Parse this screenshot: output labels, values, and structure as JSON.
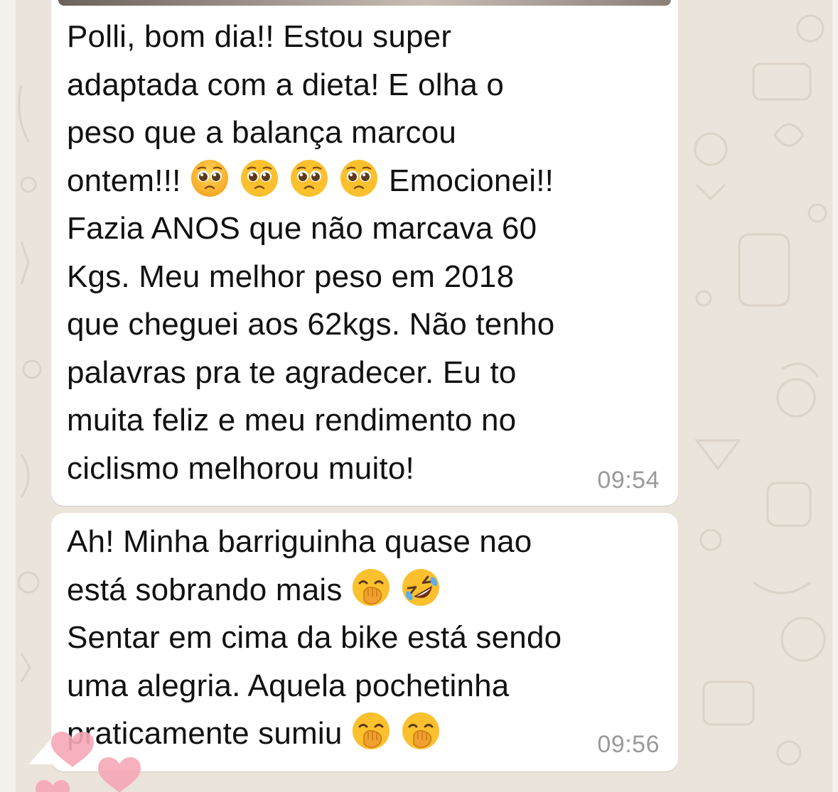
{
  "chat": {
    "messages": [
      {
        "id": "msg-1",
        "lines": [
          "Polli, bom dia!! Estou super",
          "adaptada com a dieta! E olha o",
          "peso que a balança marcou",
          "ontem!!!",
          "Emocionei!!",
          "Fazia ANOS que não marcava 60",
          "Kgs. Meu melhor peso em 2018",
          "que cheguei aos 62kgs. Não tenho",
          "palavras pra te agradecer. Eu to",
          "muita feliz e meu rendimento no",
          "ciclismo melhorou muito!"
        ],
        "time": "09:54",
        "emojis": [
          "pleading-face",
          "pleading-face",
          "pleading-face",
          "pleading-face"
        ]
      },
      {
        "id": "msg-2",
        "lines": [
          "Ah! Minha barriguinha quase nao",
          "está sobrando mais",
          "Sentar em cima da bike está sendo",
          "uma alegria. Aquela pochetinha",
          "praticamente sumiu"
        ],
        "time": "09:56",
        "emojis_line2": [
          "face-with-hand-over-mouth",
          "rolling-on-floor-laughing"
        ],
        "emojis_line5": [
          "face-with-hand-over-mouth",
          "face-with-hand-over-mouth"
        ]
      }
    ]
  },
  "colors": {
    "wallpaper": "#ece5dd",
    "bubble": "#ffffff",
    "text": "#111111",
    "timestamp": "#9a9a9a",
    "hearts": "#f7a8b8"
  }
}
